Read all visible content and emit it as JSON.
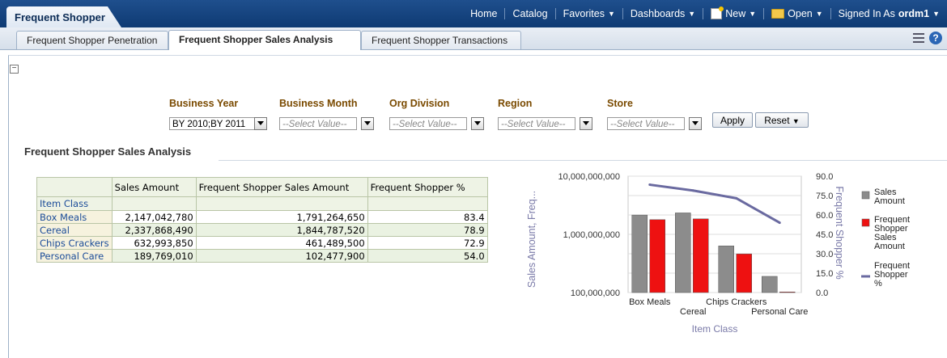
{
  "app": {
    "title": "Frequent Shopper"
  },
  "topnav": {
    "home": "Home",
    "catalog": "Catalog",
    "favorites": "Favorites",
    "dashboards": "Dashboards",
    "new": "New",
    "open": "Open",
    "signed_in_label": "Signed In As",
    "user": "ordm1"
  },
  "tabs": [
    {
      "label": "Frequent Shopper Penetration"
    },
    {
      "label": "Frequent Shopper Sales Analysis"
    },
    {
      "label": "Frequent Shopper Transactions"
    }
  ],
  "collapse_glyph": "−",
  "help_glyph": "?",
  "prompts": {
    "business_year": {
      "label": "Business Year",
      "value": "BY 2010;BY 2011"
    },
    "business_month": {
      "label": "Business Month",
      "placeholder": "--Select Value--"
    },
    "org_division": {
      "label": "Org Division",
      "placeholder": "--Select Value--"
    },
    "region": {
      "label": "Region",
      "placeholder": "--Select Value--"
    },
    "store": {
      "label": "Store",
      "placeholder": "--Select Value--"
    },
    "apply": "Apply",
    "reset": "Reset"
  },
  "section_title": "Frequent Shopper Sales Analysis",
  "table": {
    "columns": [
      "Sales Amount",
      "Frequent Shopper Sales Amount",
      "Frequent Shopper %"
    ],
    "row_header": "Item Class",
    "rows": [
      {
        "label": "Box Meals",
        "sales": "2,147,042,780",
        "fs_sales": "1,791,264,650",
        "fs_pct": "83.4"
      },
      {
        "label": "Cereal",
        "sales": "2,337,868,490",
        "fs_sales": "1,844,787,520",
        "fs_pct": "78.9"
      },
      {
        "label": "Chips Crackers",
        "sales": "632,993,850",
        "fs_sales": "461,489,500",
        "fs_pct": "72.9"
      },
      {
        "label": "Personal Care",
        "sales": "189,769,010",
        "fs_sales": "102,477,900",
        "fs_pct": "54.0"
      }
    ]
  },
  "chart_data": {
    "type": "bar",
    "categories": [
      "Box Meals",
      "Cereal",
      "Chips Crackers",
      "Personal Care"
    ],
    "series": [
      {
        "name": "Sales Amount",
        "kind": "bar",
        "axis": "left",
        "color": "#8c8c8c",
        "values": [
          2147042780,
          2337868490,
          632993850,
          189769010
        ]
      },
      {
        "name": "Frequent Shopper Sales Amount",
        "kind": "bar",
        "axis": "left",
        "color": "#ee1111",
        "values": [
          1791264650,
          1844787520,
          461489500,
          102477900
        ]
      },
      {
        "name": "Frequent Shopper %",
        "kind": "line",
        "axis": "right",
        "color": "#6a6aa0",
        "values": [
          83.4,
          78.9,
          72.9,
          54.0
        ]
      }
    ],
    "xlabel": "Item Class",
    "ylabel": "Sales Amount, Freq...",
    "y2label": "Frequent Shopper %",
    "yscale": "log",
    "ylim": [
      100000000,
      10000000000
    ],
    "yticks": [
      "10,000,000,000",
      "1,000,000,000",
      "100,000,000"
    ],
    "y2lim": [
      0,
      90
    ],
    "y2ticks": [
      "90.0",
      "75.0",
      "60.0",
      "45.0",
      "30.0",
      "15.0",
      "0.0"
    ],
    "legend": [
      {
        "label": "Sales Amount",
        "lines": [
          "Sales",
          "Amount"
        ]
      },
      {
        "label": "Frequent Shopper Sales Amount",
        "lines": [
          "Frequent",
          "Shopper",
          "Sales",
          "Amount"
        ]
      },
      {
        "label": "Frequent Shopper %",
        "lines": [
          "Frequent",
          "Shopper",
          "%"
        ]
      }
    ],
    "legend_position": "right",
    "grid": true
  }
}
